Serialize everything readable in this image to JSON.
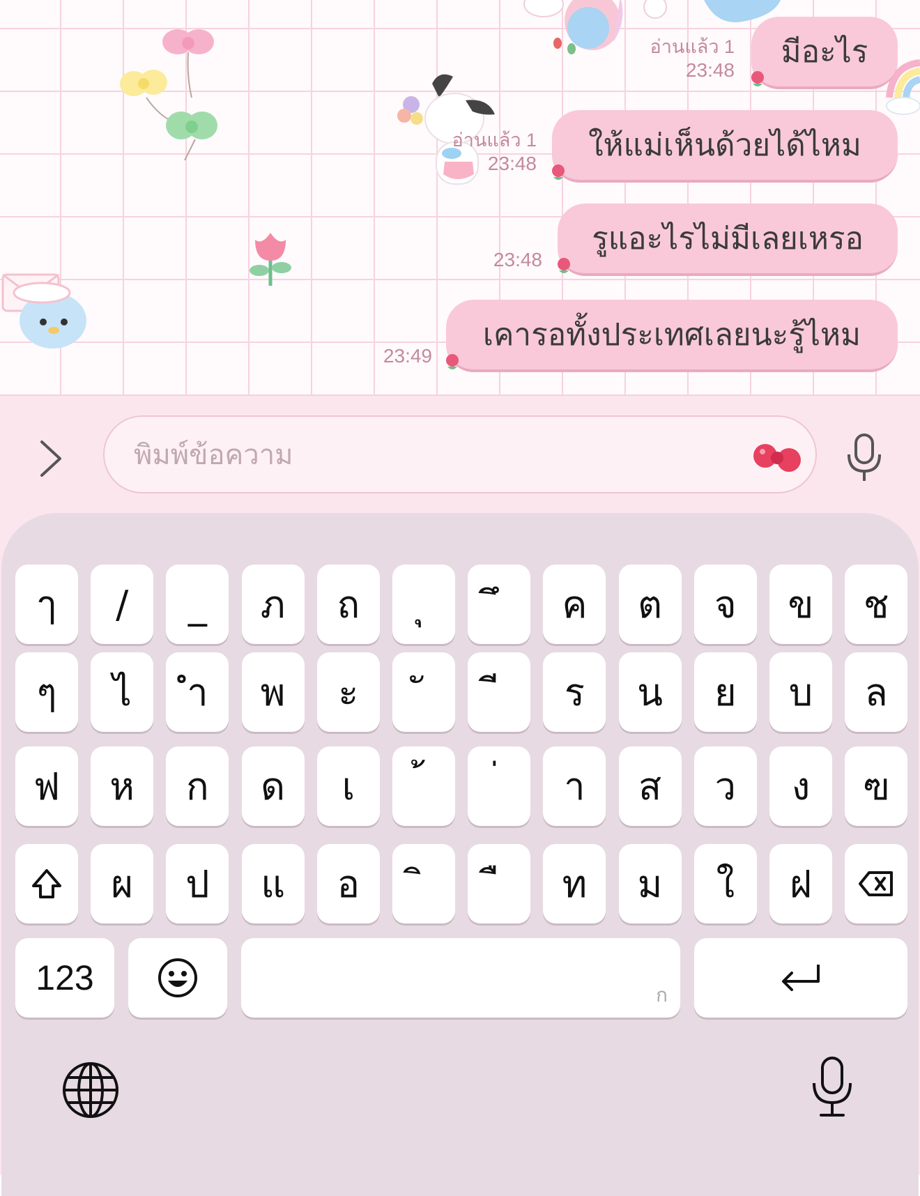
{
  "messages": [
    {
      "text": "มีอะไร",
      "read": "อ่านแล้ว 1",
      "time": "23:48"
    },
    {
      "text": "ให้แม่เห็นด้วยได้ไหม",
      "read": "อ่านแล้ว 1",
      "time": "23:48"
    },
    {
      "text": "รูแอะไรไม่มีเลยเหรอ",
      "read": "",
      "time": "23:48"
    },
    {
      "text": "เคารอทั้งประเทศเลยนะรู้ไหม",
      "read": "",
      "time": "23:49"
    }
  ],
  "input": {
    "placeholder": "พิมพ์ข้อความ",
    "value": ""
  },
  "keyboard": {
    "row1": [
      "ๅ",
      "/",
      "_",
      "ภ",
      "ถ",
      "ุ",
      "ึ",
      "ค",
      "ต",
      "จ",
      "ข",
      "ช"
    ],
    "row2": [
      "ๆ",
      "ไ",
      "ำ",
      "พ",
      "ะ",
      "ั",
      "ี",
      "ร",
      "น",
      "ย",
      "บ",
      "ล"
    ],
    "row3": [
      "ฟ",
      "ห",
      "ก",
      "ด",
      "เ",
      "้",
      "่",
      "า",
      "ส",
      "ว",
      "ง",
      "ฃ"
    ],
    "row4": [
      "ผ",
      "ป",
      "แ",
      "อ",
      "ิ",
      "ื",
      "ท",
      "ม",
      "ใ",
      "ฝ"
    ],
    "numbers_label": "123",
    "space_hint": "ก"
  },
  "colors": {
    "bubble": "#f9c9d9",
    "accent": "#e8587a",
    "keyboard_bg": "#e7dae2"
  },
  "icons": [
    "chevron-right-icon",
    "bow-sticker-icon",
    "microphone-icon",
    "shift-icon",
    "backspace-icon",
    "emoji-icon",
    "return-icon",
    "globe-icon"
  ]
}
